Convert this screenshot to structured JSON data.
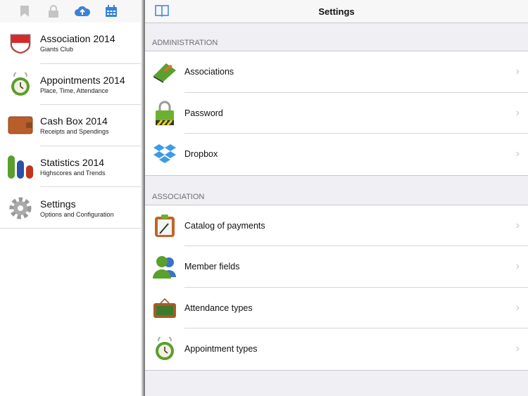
{
  "sidebar": {
    "toolbar": [
      "bookmark-icon",
      "lock-icon",
      "cloud-upload-icon",
      "calendar-icon"
    ],
    "items": [
      {
        "title": "Association 2014",
        "subtitle": "Giants Club"
      },
      {
        "title": "Appointments 2014",
        "subtitle": "Place, Time, Attendance"
      },
      {
        "title": "Cash Box 2014",
        "subtitle": "Receipts and Spendings"
      },
      {
        "title": "Statistics 2014",
        "subtitle": "Highscores and Trends"
      },
      {
        "title": "Settings",
        "subtitle": "Options and Configuration"
      }
    ]
  },
  "header": {
    "title": "Settings"
  },
  "sections": [
    {
      "title": "ADMINISTRATION",
      "rows": [
        {
          "label": "Associations"
        },
        {
          "label": "Password"
        },
        {
          "label": "Dropbox"
        }
      ]
    },
    {
      "title": "ASSOCIATION",
      "rows": [
        {
          "label": "Catalog of payments"
        },
        {
          "label": "Member fields"
        },
        {
          "label": "Attendance types"
        },
        {
          "label": "Appointment types"
        }
      ]
    }
  ],
  "chevron": "›",
  "colors": {
    "accent": "#3b82d6",
    "background": "#efeff4"
  }
}
